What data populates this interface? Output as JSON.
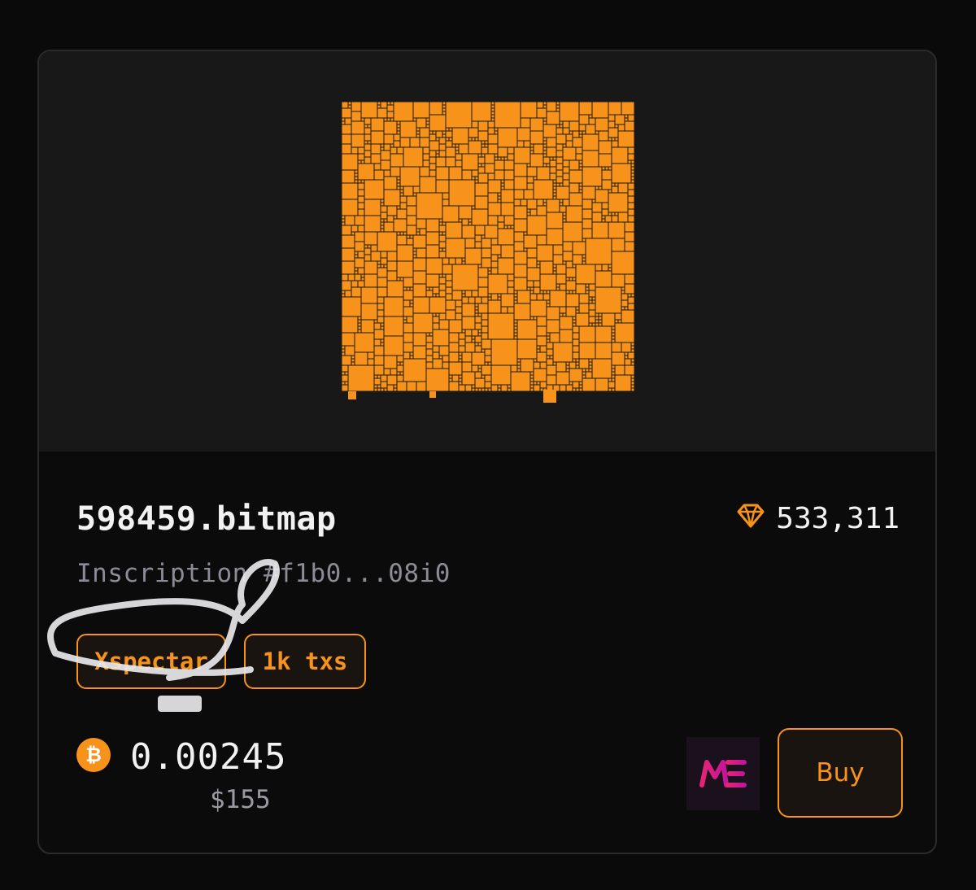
{
  "item": {
    "name": "598459.bitmap",
    "inscription": "Inscription #f1b0...08i0",
    "rarity_count": "533,311"
  },
  "tags": [
    "Xspectar",
    "1k txs"
  ],
  "price": {
    "btc": "0.00245",
    "usd": "$155"
  },
  "actions": {
    "buy_label": "Buy"
  },
  "icons": {
    "rarity": "diamond-icon",
    "currency": "bitcoin-icon",
    "marketplace": "magic-eden-logo"
  },
  "colors": {
    "accent": "#f7931a",
    "card_bg": "#0b0b0c",
    "preview_bg": "#181818",
    "text": "#f2f2f2",
    "muted": "#8c8c96",
    "marketplace_logo": "#e42575"
  }
}
